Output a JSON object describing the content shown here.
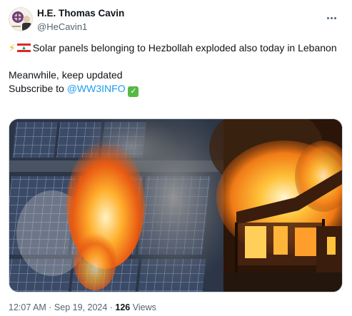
{
  "tweet": {
    "display_name": "H.E. Thomas Cavin",
    "handle": "@HeCavin1",
    "line1_text": "Solar panels belonging to Hezbollah exploded also today in Lebanon",
    "line2_text": "Meanwhile, keep updated",
    "subscribe_prefix": "Subscribe to ",
    "subscribe_link": "@WW3INFO",
    "check_emoji": "✓",
    "bolt_emoji": "⚡",
    "timestamp": "12:07 AM · Sep 19, 2024 · ",
    "views_count": "126",
    "views_label": " Views"
  },
  "colors": {
    "link": "#1d9bf0",
    "secondary_text": "#536471",
    "primary_text": "#0f1419"
  },
  "icons": {
    "more": "more-horizontal-icon",
    "lightning": "lightning-icon",
    "flag": "lebanon-flag-icon",
    "check": "check-mark-icon"
  }
}
